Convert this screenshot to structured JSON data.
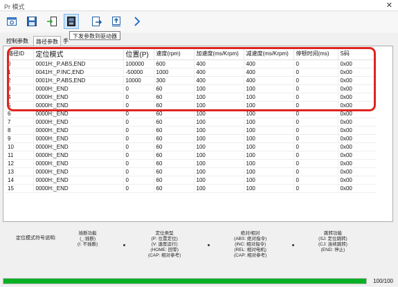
{
  "window": {
    "title": "Pr 模式",
    "close_glyph": "✕"
  },
  "toolbar": {
    "buttons": [
      {
        "icon": "preview-icon"
      },
      {
        "icon": "save-icon"
      },
      {
        "icon": "import-icon"
      },
      {
        "icon": "download-to-drive-icon",
        "active": true
      },
      {
        "icon": "export-icon"
      },
      {
        "icon": "upload-icon"
      },
      {
        "icon": "next-arrow-icon"
      }
    ],
    "tooltip": "下发参数到驱动器"
  },
  "tabs": [
    "控制参数",
    "路径参数",
    "手"
  ],
  "table": {
    "headers": [
      "路径ID",
      "定位模式",
      "位置(P)",
      "速度(rpm)",
      "加速度(ms/Krpm)",
      "减速度(ms/Krpm)",
      "停顿时间(ms)",
      "S码"
    ],
    "rows": [
      [
        "0",
        "0001H:_P.ABS,END",
        "100000",
        "600",
        "400",
        "400",
        "0",
        "0x00"
      ],
      [
        "1",
        "0041H:_P.INC,END",
        "-50000",
        "1000",
        "400",
        "400",
        "0",
        "0x00"
      ],
      [
        "2",
        "0001H:_P.ABS,END",
        "10000",
        "300",
        "400",
        "400",
        "0",
        "0x00"
      ],
      [
        "3",
        "0000H:_END",
        "0",
        "60",
        "100",
        "100",
        "0",
        "0x00"
      ],
      [
        "4",
        "0000H:_END",
        "0",
        "60",
        "100",
        "100",
        "0",
        "0x00"
      ],
      [
        "5",
        "0000H:_END",
        "0",
        "60",
        "100",
        "100",
        "0",
        "0x00"
      ],
      [
        "6",
        "0000H:_END",
        "0",
        "60",
        "100",
        "100",
        "0",
        "0x00"
      ],
      [
        "7",
        "0000H:_END",
        "0",
        "60",
        "100",
        "100",
        "0",
        "0x00"
      ],
      [
        "8",
        "0000H:_END",
        "0",
        "60",
        "100",
        "100",
        "0",
        "0x00"
      ],
      [
        "9",
        "0000H:_END",
        "0",
        "60",
        "100",
        "100",
        "0",
        "0x00"
      ],
      [
        "10",
        "0000H:_END",
        "0",
        "60",
        "100",
        "100",
        "0",
        "0x00"
      ],
      [
        "11",
        "0000H:_END",
        "0",
        "60",
        "100",
        "100",
        "0",
        "0x00"
      ],
      [
        "12",
        "0000H:_END",
        "0",
        "60",
        "100",
        "100",
        "0",
        "0x00"
      ],
      [
        "13",
        "0000H:_END",
        "0",
        "60",
        "100",
        "100",
        "0",
        "0x00"
      ],
      [
        "14",
        "0000H:_END",
        "0",
        "60",
        "100",
        "100",
        "0",
        "0x00"
      ],
      [
        "15",
        "0000H:_END",
        "0",
        "60",
        "100",
        "100",
        "0",
        "0x00"
      ]
    ]
  },
  "legend": {
    "intro": "定位模式符号说明:",
    "groups": [
      {
        "lines": [
          "插断功能",
          "(_:插断)",
          "(I: 不插断)"
        ]
      },
      {
        "lines": [
          "定位类型",
          "(P: 位置定位)",
          "(V: 速度运行)",
          "(HOME: 回零)",
          "(CAP: 相对参考)"
        ]
      },
      {
        "lines": [
          "绝对/相对",
          "(ABS: 绝对指令)",
          "(INC: 相对指令)",
          "(REL: 相对电机)",
          "(CAP: 相对参考)"
        ]
      },
      {
        "lines": [
          "跳转功能",
          "(SJ: 定位跳转)",
          "(CJ: 连续跳转)",
          "(END: 停止)"
        ]
      }
    ]
  },
  "progress": {
    "value": 100,
    "max": 100,
    "text": "100/100"
  },
  "colors": {
    "highlight": "#e0221f",
    "progress": "#06b025",
    "tab_active": "#ffffff"
  }
}
